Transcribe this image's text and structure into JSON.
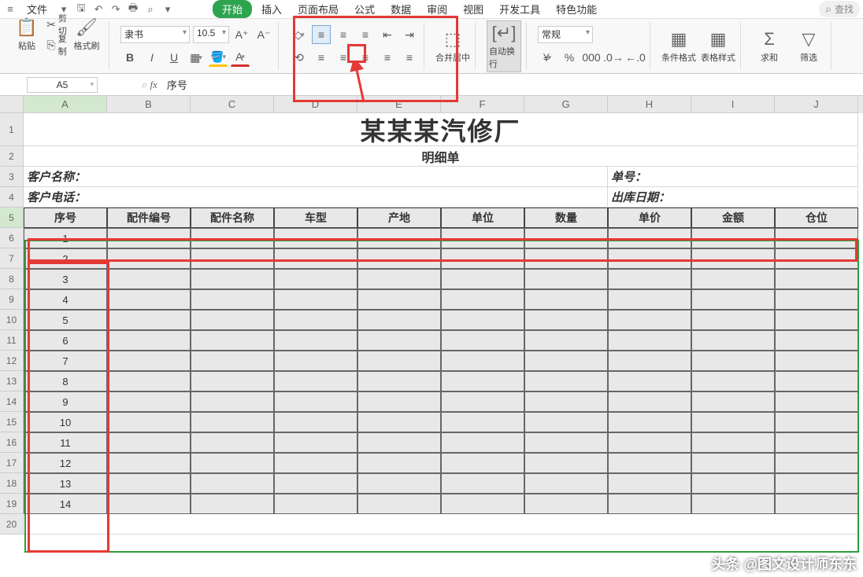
{
  "menubar": {
    "file": "文件",
    "items": [
      "开始",
      "插入",
      "页面布局",
      "公式",
      "数据",
      "审阅",
      "视图",
      "开发工具",
      "特色功能"
    ],
    "search": "查找"
  },
  "ribbon": {
    "paste": "粘贴",
    "cut": "剪切",
    "copy": "复制",
    "format_painter": "格式刷",
    "font_name": "隶书",
    "font_size": "10.5",
    "merge_center": "合并居中",
    "auto_wrap": "自动换行",
    "number_format": "常规",
    "cond_format": "条件格式",
    "cell_style": "表格样式",
    "sum": "求和",
    "filter": "筛选"
  },
  "namebox": "A5",
  "formula": "序号",
  "sheet": {
    "title": "某某某汽修厂",
    "subtitle": "明细单",
    "customer_name_label": "客户名称：",
    "order_no_label": "单号：",
    "customer_tel_label": "客户电话：",
    "out_date_label": "出库日期：",
    "headers": [
      "序号",
      "配件编号",
      "配件名称",
      "车型",
      "产地",
      "单位",
      "数量",
      "单价",
      "金额",
      "仓位"
    ],
    "nums": [
      "1",
      "2",
      "3",
      "4",
      "5",
      "6",
      "7",
      "8",
      "9",
      "10",
      "11",
      "12",
      "13",
      "14"
    ]
  },
  "columns": [
    "A",
    "B",
    "C",
    "D",
    "E",
    "F",
    "G",
    "H",
    "I",
    "J"
  ],
  "rows": [
    "1",
    "2",
    "3",
    "4",
    "5",
    "6",
    "7",
    "8",
    "9",
    "10",
    "11",
    "12",
    "13",
    "14",
    "15",
    "16",
    "17",
    "18",
    "19",
    "20"
  ],
  "watermark": "头条 @图文设计师东东"
}
